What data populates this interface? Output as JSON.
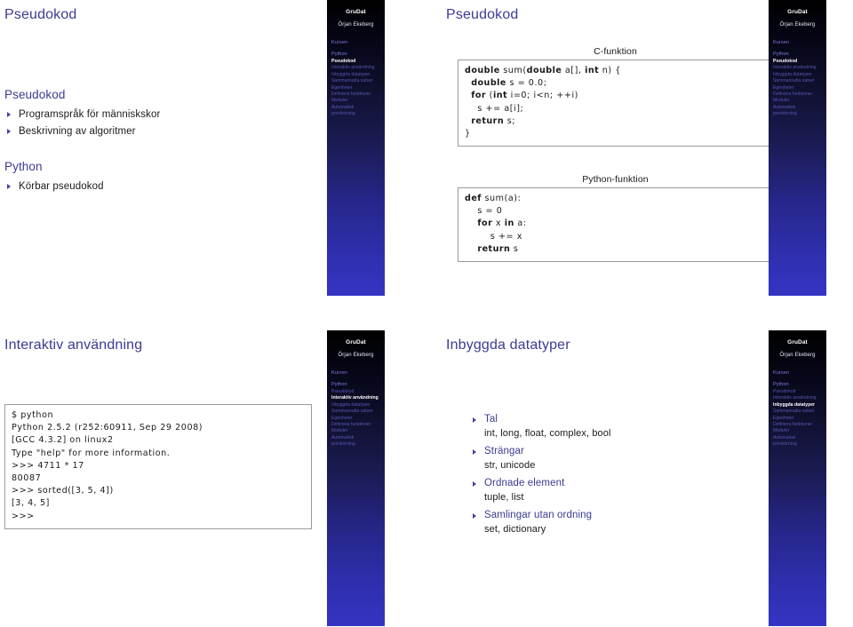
{
  "theme": {
    "title_color": "#3b3b95",
    "body_color": "#1a1a1a",
    "sidebar_top_color": "#000000",
    "sidebar_bottom_color": "#3434c4",
    "sidebar_active_color": "#ffffff",
    "sidebar_section_color": "#7d7de0",
    "sidebar_subsection_color": "#5858b4",
    "codebox_border_color": "#9a9a9a"
  },
  "sidebar": {
    "title": "GruDat",
    "author": "Örjan Ekeberg",
    "nav": [
      {
        "label": "Kursen",
        "level": "section"
      },
      {
        "label": "Python",
        "level": "section"
      },
      {
        "label": "Pseudokod",
        "level": "subsection"
      },
      {
        "label": "Interaktiv användning",
        "level": "subsection"
      },
      {
        "label": "Inbyggda datatyper",
        "level": "subsection"
      },
      {
        "label": "Sammansatta satser",
        "level": "subsection"
      },
      {
        "label": "Egenheter",
        "level": "subsection"
      },
      {
        "label": "Definiera funktioner",
        "level": "subsection"
      },
      {
        "label": "Moduler",
        "level": "subsection"
      },
      {
        "label": "Automatisk",
        "level": "subsection"
      },
      {
        "label": "provkörning",
        "level": "subsection"
      }
    ]
  },
  "slides": [
    {
      "id": "slide-pseudokod-intro",
      "title": "Pseudokod",
      "active_nav": "Pseudokod",
      "blocks": [
        {
          "head": "Pseudokod",
          "items": [
            "Programspråk för människskor",
            "Beskrivning av algoritmer"
          ]
        },
        {
          "head": "Python",
          "items": [
            "Körbar pseudokod"
          ]
        }
      ]
    },
    {
      "id": "slide-pseudokod-code",
      "title": "Pseudokod",
      "active_nav": "Pseudokod",
      "code_blocks": [
        {
          "caption": "C-funktion",
          "lines": [
            "double sum(double a[], int n) {",
            "  double s = 0.0;",
            "  for (int i=0; i<n; ++i)",
            "    s += a[i];",
            "  return s;",
            "}"
          ]
        },
        {
          "caption": "Python-funktion",
          "lines": [
            "def sum(a):",
            "    s = 0",
            "    for x in a:",
            "        s += x",
            "    return s"
          ]
        }
      ]
    },
    {
      "id": "slide-interaktiv",
      "title": "Interaktiv användning",
      "active_nav": "Interaktiv användning",
      "terminal": {
        "lines": [
          "$ python",
          "Python 2.5.2 (r252:60911, Sep 29 2008)",
          "[GCC 4.3.2] on linux2",
          "Type \"help\" for more information.",
          ">>> 4711 * 17",
          "80087",
          ">>> sorted([3, 5, 4])",
          "[3, 4, 5]",
          ">>>"
        ]
      }
    },
    {
      "id": "slide-datatyper",
      "title": "Inbyggda datatyper",
      "active_nav": "Inbyggda datatyper",
      "pairs": [
        {
          "title": "Tal",
          "sub": "int, long, float, complex, bool"
        },
        {
          "title": "Strängar",
          "sub": "str, unicode"
        },
        {
          "title": "Ordnade element",
          "sub": "tuple, list"
        },
        {
          "title": "Samlingar utan ordning",
          "sub": "set, dictionary"
        }
      ]
    }
  ]
}
